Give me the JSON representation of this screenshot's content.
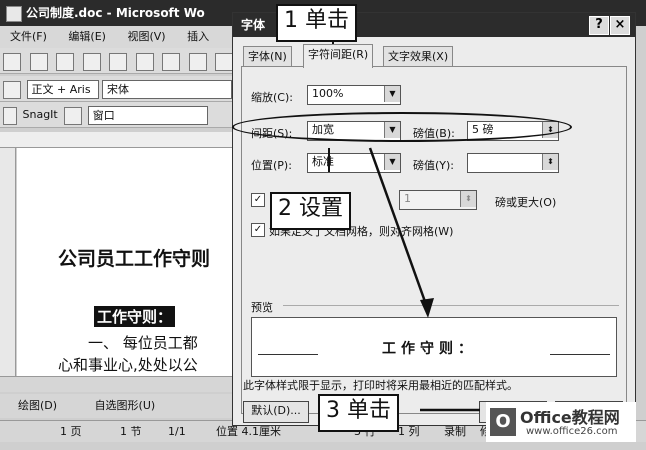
{
  "word": {
    "title": "公司制度.doc - Microsoft Wo",
    "menu": [
      "文件(F)",
      "编辑(E)",
      "视图(V)",
      "插入"
    ],
    "style_box": "正文 + Aris",
    "font_box": "宋体",
    "snagit": "SnagIt",
    "window_box": "窗口",
    "doc_heading": "公司员工工作守则",
    "doc_rule_title": "工作守则：",
    "doc_line1": "一、 每位员工都",
    "doc_line2": "心和事业心,处处以公",
    "draw_label": "绘图(D)",
    "autoshape_label": "自选图形(U)",
    "status": {
      "page": "1 页",
      "section": "1 节",
      "pages": "1/1",
      "position": "位置 4.1厘米",
      "line": "3 行",
      "col": "1 列",
      "rec": "录制",
      "rev": "修订"
    }
  },
  "dialog": {
    "title": "字体",
    "help": "?",
    "close": "×",
    "tabs": [
      "字体(N)",
      "字符间距(R)",
      "文字效果(X)"
    ],
    "scale_label": "缩放(C):",
    "scale_value": "100%",
    "spacing_label": "间距(S):",
    "spacing_value": "加宽",
    "spacing_by_label": "磅值(B):",
    "spacing_by_value": "5 磅",
    "position_label": "位置(P):",
    "position_value": "标准",
    "position_by_label": "磅值(Y):",
    "kerning_value": "1",
    "kerning_suffix": "磅或更大(O)",
    "grid_label": "如果定义了文档网格，则对齐网格(W)",
    "preview_label": "预览",
    "preview_text": "工作守则：",
    "preview_note": "此字体样式限于显示，打印时将采用最相近的匹配样式。",
    "default_button": "默认(D)...",
    "ok_button": "确定",
    "cancel_button": "取消"
  },
  "callouts": {
    "step1": "1 单击",
    "step2": "2 设置",
    "step3": "3 单击"
  },
  "logo": {
    "mark": "O",
    "name": "Office教程网",
    "url": "www.office26.com"
  }
}
